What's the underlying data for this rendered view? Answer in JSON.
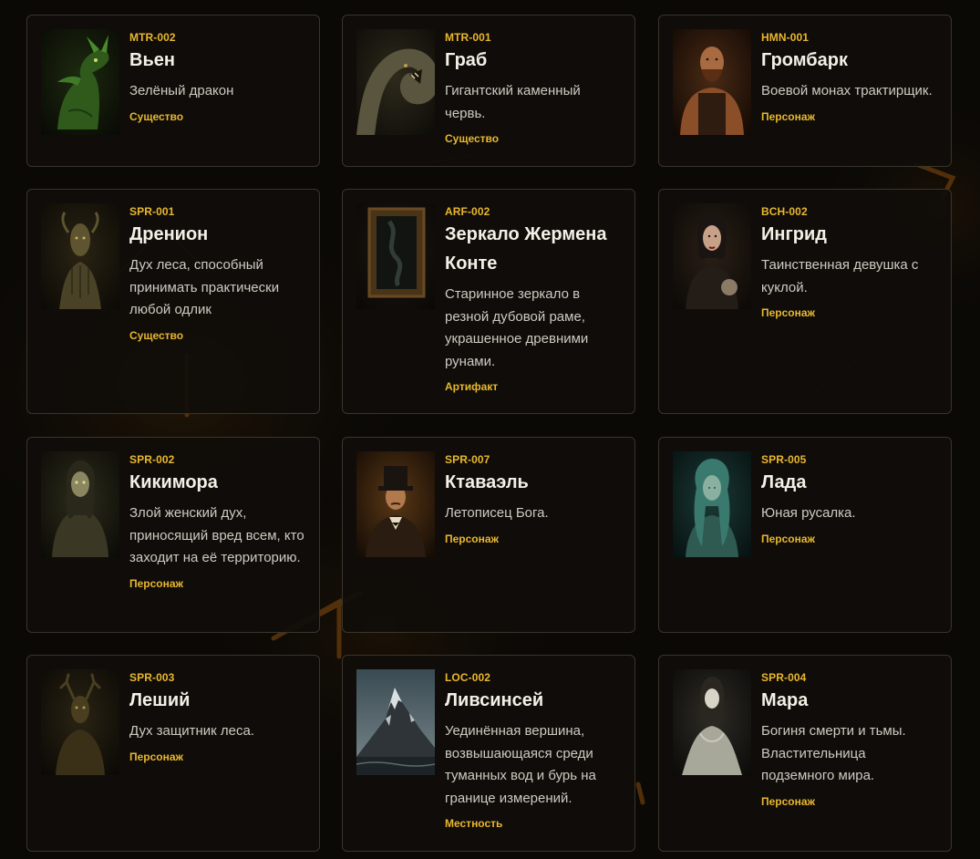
{
  "colors": {
    "background": "#0b0906",
    "card_background": "#100d0a",
    "card_border": "#3a342b",
    "accent": "#e9b72e",
    "title": "#f5f0e6",
    "text": "#cfcac1"
  },
  "cards": [
    {
      "code": "MTR-002",
      "name": "Вьен",
      "description": "Зелёный дракон",
      "type": "Существо",
      "image": "green-dragon-portrait"
    },
    {
      "code": "MTR-001",
      "name": "Граб",
      "description": "Гигантский каменный червь.",
      "type": "Существо",
      "image": "stone-worm-portrait"
    },
    {
      "code": "HMN-001",
      "name": "Громбарк",
      "description": "Воевой монах трактирщик.",
      "type": "Персонаж",
      "image": "monk-portrait"
    },
    {
      "code": "SPR-001",
      "name": "Дренион",
      "description": "Дух леса, способный принимать практически любой одлик",
      "type": "Существо",
      "image": "forest-spirit-portrait"
    },
    {
      "code": "ARF-002",
      "name": "Зеркало Жермена Конте",
      "description": "Старинное зеркало в резной дубовой раме, украшенное древними рунами.",
      "type": "Артифакт",
      "image": "mirror-image"
    },
    {
      "code": "BCH-002",
      "name": "Ингрид",
      "description": "Таинственная девушка с куклой.",
      "type": "Персонаж",
      "image": "girl-portrait"
    },
    {
      "code": "SPR-002",
      "name": "Кикимора",
      "description": "Злой женский дух, приносящий вред всем, кто заходит на её территорию.",
      "type": "Персонаж",
      "image": "kikimora-portrait"
    },
    {
      "code": "SPR-007",
      "name": "Ктаваэль",
      "description": "Летописец Бога.",
      "type": "Персонаж",
      "image": "top-hat-man-portrait"
    },
    {
      "code": "SPR-005",
      "name": "Лада",
      "description": "Юная русалка.",
      "type": "Персонаж",
      "image": "mermaid-portrait"
    },
    {
      "code": "SPR-003",
      "name": "Леший",
      "description": "Дух защитник леса.",
      "type": "Персонаж",
      "image": "leshy-portrait"
    },
    {
      "code": "LOC-002",
      "name": "Ливсинсей",
      "description": "Уединённая вершина, возвышающаяся среди туманных вод и бурь на границе измерений.",
      "type": "Местность",
      "image": "mountain-image"
    },
    {
      "code": "SPR-004",
      "name": "Мара",
      "description": "Богиня смерти и тьмы. Властительница подземного мира.",
      "type": "Персонаж",
      "image": "pale-woman-portrait"
    }
  ]
}
